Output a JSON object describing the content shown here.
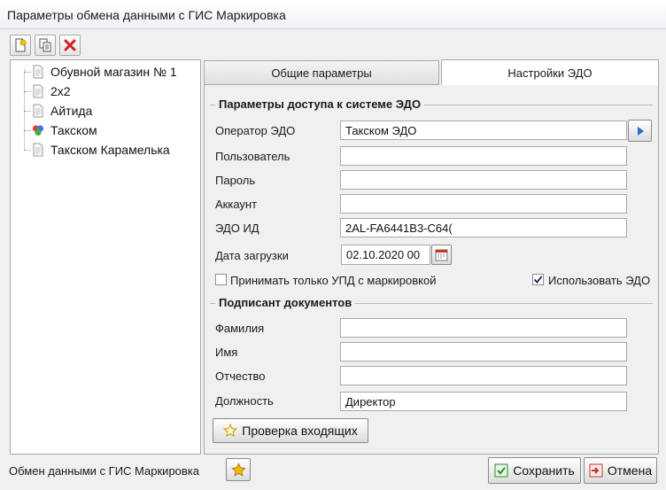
{
  "window": {
    "title": "Параметры обмена данными с ГИС Маркировка"
  },
  "toolbar": {
    "buttons": [
      {
        "icon": "add-icon"
      },
      {
        "icon": "copy-icon"
      },
      {
        "icon": "delete-icon"
      }
    ]
  },
  "tree": {
    "items": [
      {
        "label": "Обувной магазин № 1",
        "icon": "document-icon"
      },
      {
        "label": "2х2",
        "icon": "document-icon"
      },
      {
        "label": "Айтида",
        "icon": "document-icon"
      },
      {
        "label": "Такском",
        "icon": "colored-circles-icon"
      },
      {
        "label": "Такском Карамелька",
        "icon": "document-icon"
      }
    ]
  },
  "tabs": [
    {
      "label": "Общие параметры"
    },
    {
      "label": "Настройки ЭДО"
    }
  ],
  "edo_access": {
    "group_title": "Параметры доступа к системе ЭДО",
    "operator_label": "Оператор ЭДО",
    "operator_value": "Такском ЭДО",
    "user_label": "Пользователь",
    "user_value": "",
    "password_label": "Пароль",
    "password_value": "",
    "account_label": "Аккаунт",
    "account_value": "",
    "edo_id_label": "ЭДО ИД",
    "edo_id_value": "2AL-FA6441B3-C64(",
    "date_label": "Дата загрузки",
    "date_value": "02.10.2020 00",
    "only_upd_label": "Принимать только УПД с маркировкой",
    "only_upd_checked": false,
    "use_edo_label": "Использовать ЭДО",
    "use_edo_checked": true
  },
  "signer": {
    "group_title": "Подписант документов",
    "last_name_label": "Фамилия",
    "last_name_value": "",
    "first_name_label": "Имя",
    "first_name_value": "",
    "patronymic_label": "Отчество",
    "patronymic_value": "",
    "position_label": "Должность",
    "position_value": "Директор"
  },
  "check_incoming_label": "Проверка входящих",
  "footer": {
    "label": "Обмен данными с ГИС Маркировка",
    "save_label": "Сохранить",
    "cancel_label": "Отмена"
  },
  "colors": {
    "accent": "#1f6fd1",
    "delete": "#d11f1f",
    "star": "#f2b705"
  }
}
